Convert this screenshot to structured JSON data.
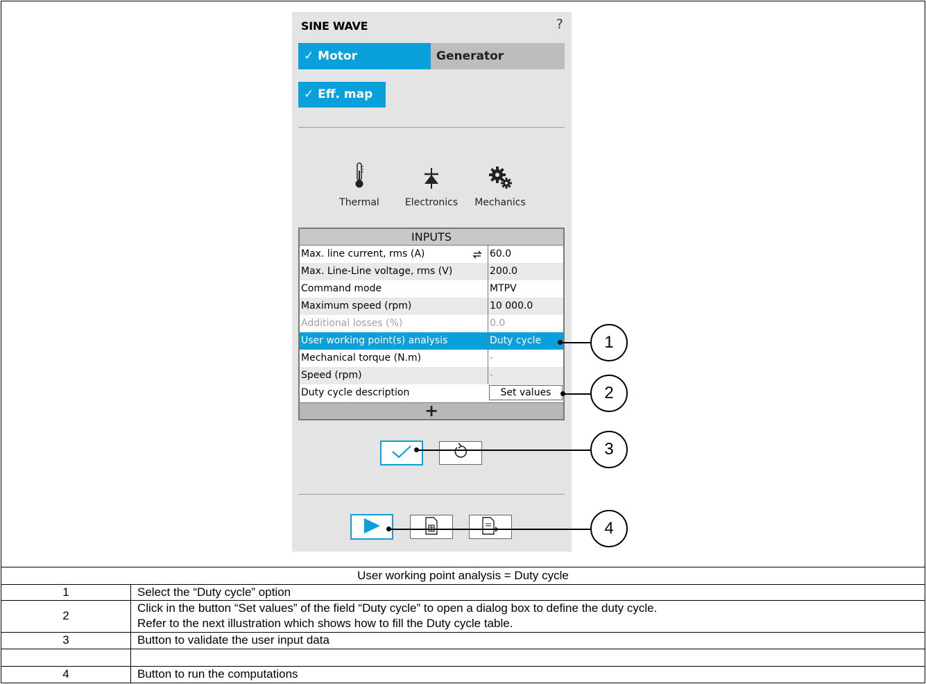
{
  "panel": {
    "title": "SINE WAVE",
    "help_label": "?",
    "tabs": {
      "motor": "✓ Motor",
      "generator": "Generator"
    },
    "eff_map_label": "✓ Eff. map",
    "tools": [
      {
        "label": "Thermal",
        "icon": "thermometer-icon"
      },
      {
        "label": "Electronics",
        "icon": "diode-icon"
      },
      {
        "label": "Mechanics",
        "icon": "gears-icon"
      }
    ],
    "inputs": {
      "header": "INPUTS",
      "rows": [
        {
          "label": "Max. line current, rms (A)",
          "value": "60.0"
        },
        {
          "label": "Max. Line-Line voltage, rms (V)",
          "value": "200.0"
        },
        {
          "label": "Command mode",
          "value": "MTPV"
        },
        {
          "label": "Maximum speed (rpm)",
          "value": "10 000.0"
        },
        {
          "label": "Additional losses (%)",
          "value": "0.0"
        },
        {
          "label": "User working point(s) analysis",
          "value": "Duty cycle"
        },
        {
          "label": "Mechanical torque (N.m)",
          "value": "-"
        },
        {
          "label": "Speed (rpm)",
          "value": "-"
        },
        {
          "label": "Duty cycle description",
          "value": "Set values"
        }
      ],
      "add_label": "+"
    },
    "colors": {
      "accent": "#0aa0dc",
      "panel_bg": "#e4e4e4"
    }
  },
  "callouts": [
    "1",
    "2",
    "3",
    "4"
  ],
  "doc": {
    "caption": "User working point analysis = Duty cycle",
    "rows": [
      {
        "num": "1",
        "text": "Select the “Duty cycle” option"
      },
      {
        "num": "2",
        "text": "Click in the button “Set values” of the field “Duty cycle” to open a dialog box to define the duty cycle.",
        "text2": "Refer to the next illustration which shows how to fill the Duty cycle table."
      },
      {
        "num": "3",
        "text": "Button to validate the user input data"
      },
      {
        "num": "4",
        "text": "Button to run the computations"
      }
    ]
  }
}
